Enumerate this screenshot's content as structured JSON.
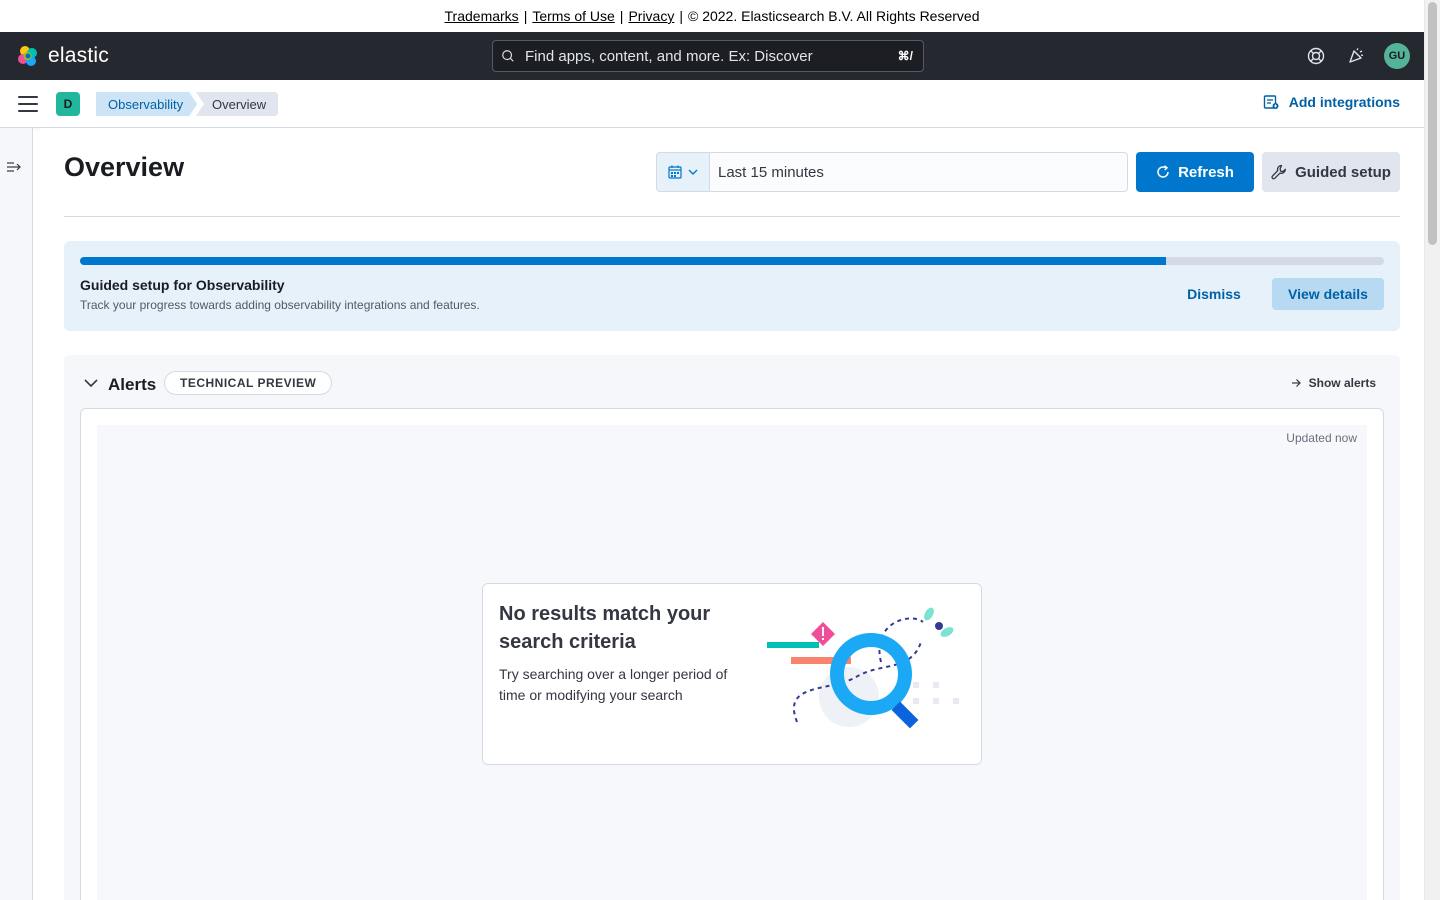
{
  "legal": {
    "trademarks": "Trademarks",
    "terms": "Terms of Use",
    "privacy": "Privacy",
    "copyright": "© 2022. Elasticsearch B.V. All Rights Reserved",
    "separator": "|"
  },
  "topnav": {
    "logo_text": "elastic",
    "search_placeholder": "Find apps, content, and more. Ex: Discover",
    "search_shortcut": "⌘/",
    "avatar_initials": "GU"
  },
  "subnav": {
    "space_initial": "D",
    "breadcrumbs": [
      "Observability",
      "Overview"
    ],
    "add_integrations": "Add integrations"
  },
  "page": {
    "title": "Overview",
    "date_range": "Last 15 minutes",
    "refresh": "Refresh",
    "guided_setup": "Guided setup"
  },
  "guide": {
    "title": "Guided setup for Observability",
    "description": "Track your progress towards adding observability integrations and features.",
    "dismiss": "Dismiss",
    "view_details": "View details",
    "progress": 0.833
  },
  "alerts": {
    "title": "Alerts",
    "badge": "TECHNICAL PREVIEW",
    "show_alerts": "Show alerts",
    "updated": "Updated now",
    "empty_title": "No results match your search criteria",
    "empty_body": "Try searching over a longer period of time or modifying your search"
  },
  "colors": {
    "primary": "#0077cc",
    "header_bg": "#25282f",
    "panel_bg": "#e6f1fa",
    "avatar": "#54b399",
    "space_badge": "#20b79c"
  },
  "icons": [
    "elastic-logo-icon",
    "search-icon",
    "help-icon",
    "newsfeed-icon",
    "menu-icon",
    "integrations-icon",
    "calendar-icon",
    "chevron-down-icon",
    "refresh-icon",
    "wrench-icon",
    "arrow-right-icon",
    "menu-expand-icon"
  ]
}
